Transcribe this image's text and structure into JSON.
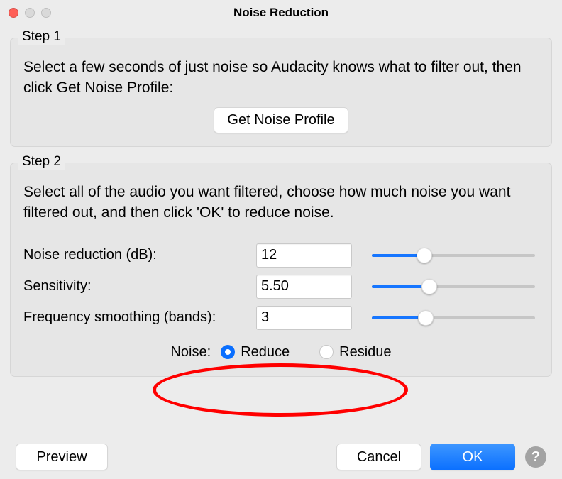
{
  "window": {
    "title": "Noise Reduction"
  },
  "step1": {
    "label": "Step 1",
    "text": "Select a few seconds of just noise so Audacity knows what to filter out, then click Get Noise Profile:",
    "button": "Get Noise Profile"
  },
  "step2": {
    "label": "Step 2",
    "text": "Select all of the audio you want filtered, choose how much noise you want filtered out, and then click 'OK' to reduce noise.",
    "params": {
      "reduction": {
        "label": "Noise reduction (dB):",
        "value": "12",
        "slider_pct": 32
      },
      "sensitivity": {
        "label": "Sensitivity:",
        "value": "5.50",
        "slider_pct": 35
      },
      "smoothing": {
        "label": "Frequency smoothing (bands):",
        "value": "3",
        "slider_pct": 33
      }
    },
    "noise_label": "Noise:",
    "noise_options": {
      "reduce": "Reduce",
      "residue": "Residue"
    },
    "noise_selected": "reduce"
  },
  "buttons": {
    "preview": "Preview",
    "cancel": "Cancel",
    "ok": "OK",
    "help": "?"
  },
  "annotation": {
    "color": "#ff0000"
  }
}
